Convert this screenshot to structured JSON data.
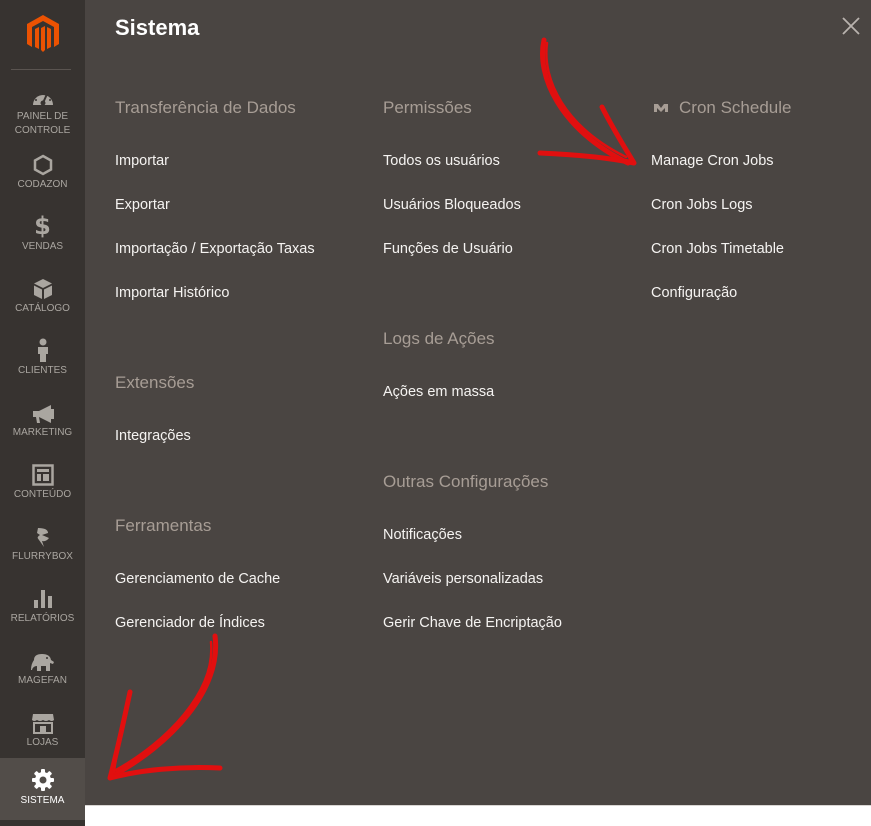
{
  "sidebar": {
    "logo": "magento-logo-icon",
    "items": [
      {
        "label": "PAINEL DE CONTROLE",
        "icon": "dashboard-icon"
      },
      {
        "label": "CODAZON",
        "icon": "hexagon-icon"
      },
      {
        "label": "VENDAS",
        "icon": "dollar-icon"
      },
      {
        "label": "CATÁLOGO",
        "icon": "cube-icon"
      },
      {
        "label": "CLIENTES",
        "icon": "person-icon"
      },
      {
        "label": "MARKETING",
        "icon": "megaphone-icon"
      },
      {
        "label": "CONTEÚDO",
        "icon": "layout-icon"
      },
      {
        "label": "FLURRYBOX",
        "icon": "flurrybox-icon"
      },
      {
        "label": "RELATÓRIOS",
        "icon": "bar-chart-icon"
      },
      {
        "label": "MAGEFAN",
        "icon": "elephant-icon"
      },
      {
        "label": "LOJAS",
        "icon": "store-icon"
      },
      {
        "label": "SISTEMA",
        "icon": "gear-icon",
        "active": true
      }
    ]
  },
  "panel": {
    "title": "Sistema",
    "close_icon": "close-icon",
    "groups": {
      "transferencia": {
        "title": "Transferência de Dados",
        "links": [
          "Importar",
          "Exportar",
          "Importação / Exportação Taxas",
          "Importar Histórico"
        ]
      },
      "extensoes": {
        "title": "Extensões",
        "links": [
          "Integrações"
        ]
      },
      "ferramentas": {
        "title": "Ferramentas",
        "links": [
          "Gerenciamento de Cache",
          "Gerenciador de Índices"
        ]
      },
      "permissoes": {
        "title": "Permissões",
        "links": [
          "Todos os usuários",
          "Usuários Bloqueados",
          "Funções de Usuário"
        ]
      },
      "logs": {
        "title": "Logs de Ações",
        "links": [
          "Ações em massa"
        ]
      },
      "outras": {
        "title": "Outras Configurações",
        "links": [
          "Notificações",
          "Variáveis personalizadas",
          "Gerir Chave de Encriptação"
        ]
      },
      "cron": {
        "title": "Cron Schedule",
        "icon": "cron-extension-icon",
        "links": [
          "Manage Cron Jobs",
          "Cron Jobs Logs",
          "Cron Jobs Timetable",
          "Configuração"
        ]
      }
    }
  },
  "colors": {
    "sidebar_bg": "#373330",
    "panel_bg": "#4a4542",
    "logo_orange": "#eb5202",
    "annotation_red": "#e10f0f"
  }
}
